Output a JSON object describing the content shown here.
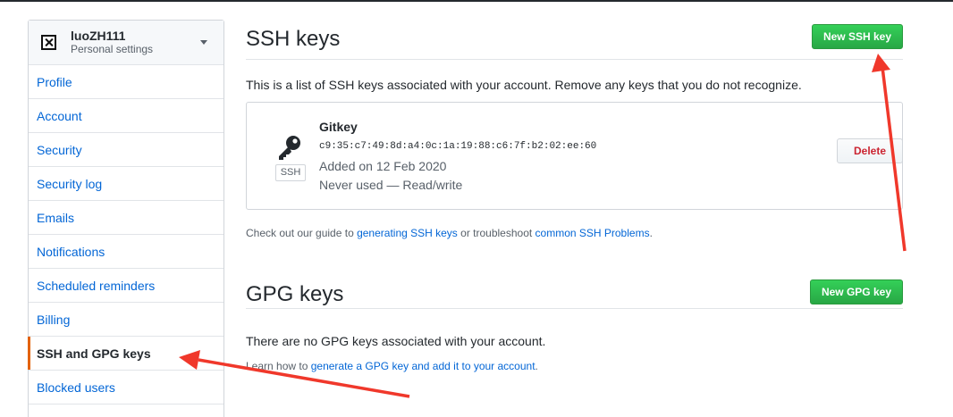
{
  "sidebar": {
    "username": "luoZH111",
    "context": "Personal settings",
    "items": [
      {
        "label": "Profile"
      },
      {
        "label": "Account"
      },
      {
        "label": "Security"
      },
      {
        "label": "Security log"
      },
      {
        "label": "Emails"
      },
      {
        "label": "Notifications"
      },
      {
        "label": "Scheduled reminders"
      },
      {
        "label": "Billing"
      },
      {
        "label": "SSH and GPG keys",
        "selected": true
      },
      {
        "label": "Blocked users"
      }
    ]
  },
  "ssh": {
    "title": "SSH keys",
    "new_button": "New SSH key",
    "description": "This is a list of SSH keys associated with your account. Remove any keys that you do not recognize.",
    "key": {
      "type_label": "SSH",
      "title": "Gitkey",
      "fingerprint": "c9:35:c7:49:8d:a4:0c:1a:19:88:c6:7f:b2:02:ee:60",
      "added": "Added on 12 Feb 2020",
      "usage": "Never used — Read/write",
      "delete_label": "Delete"
    },
    "guide": {
      "prefix": "Check out our guide to ",
      "link1": "generating SSH keys",
      "middle": " or troubleshoot ",
      "link2": "common SSH Problems",
      "suffix": "."
    }
  },
  "gpg": {
    "title": "GPG keys",
    "new_button": "New GPG key",
    "empty": "There are no GPG keys associated with your account.",
    "learn": {
      "prefix": "Learn how to ",
      "link": "generate a GPG key and add it to your account",
      "suffix": "."
    }
  },
  "colors": {
    "link": "#0366d6",
    "green": "#28a745",
    "danger": "#cb2431",
    "annotation": "#f0382b",
    "selected_border": "#e36209"
  },
  "icons": [
    "avatar-icon",
    "chevron-down-icon",
    "key-icon"
  ]
}
